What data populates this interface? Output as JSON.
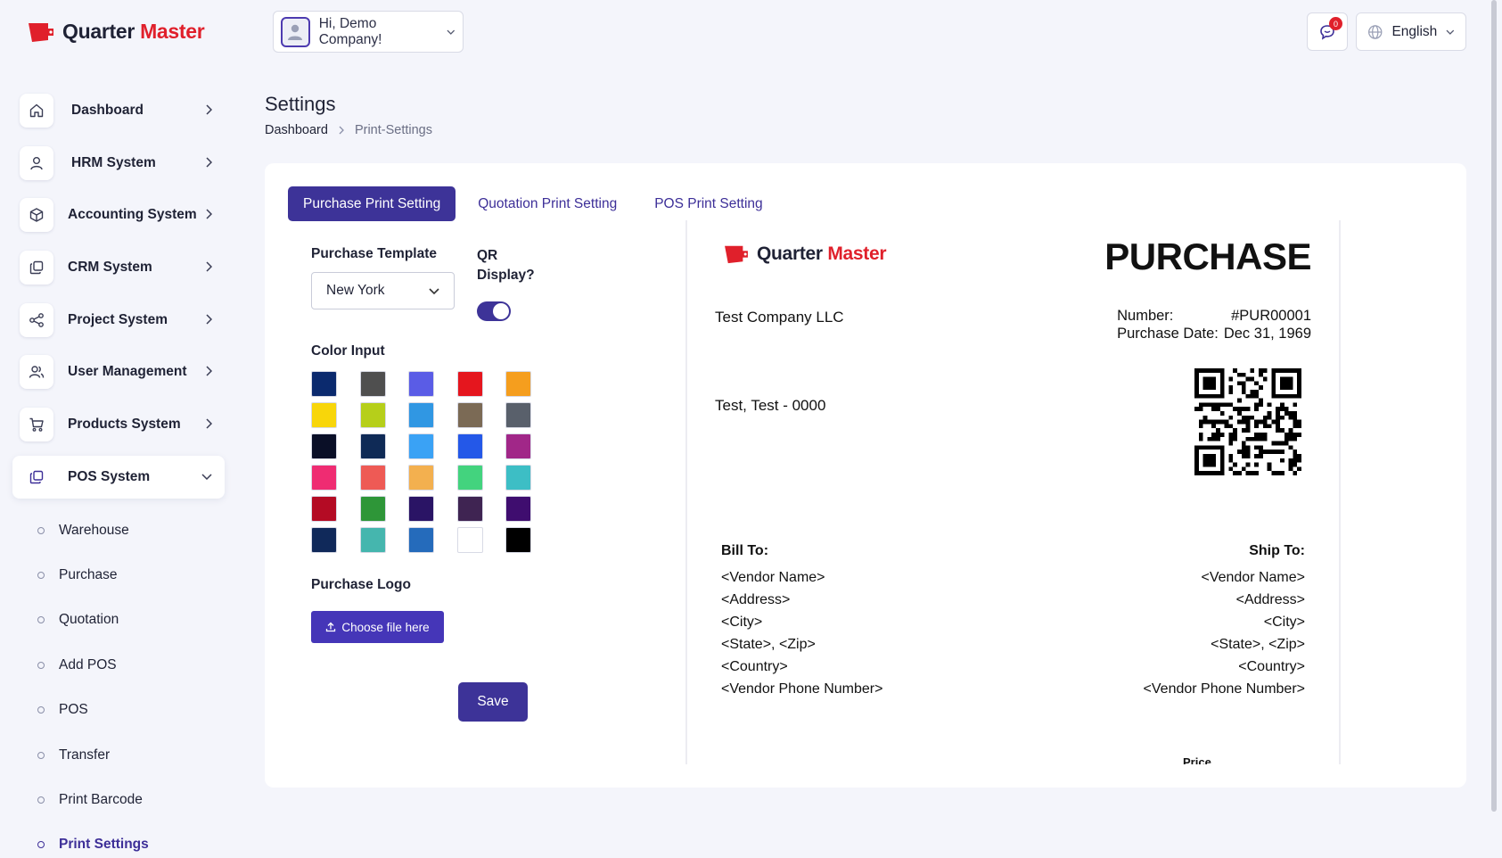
{
  "brand": {
    "name_part1": "Quarter",
    "name_part2": "Master",
    "red": "#e0202b",
    "dark": "#1f2235"
  },
  "header": {
    "greeting": "Hi, Demo Company!",
    "notification_count": "0",
    "language": "English"
  },
  "sidebar": {
    "items": [
      {
        "label": "Dashboard",
        "icon": "home-icon"
      },
      {
        "label": "HRM System",
        "icon": "user-icon"
      },
      {
        "label": "Accounting System",
        "icon": "box-icon"
      },
      {
        "label": "CRM System",
        "icon": "layers-icon"
      },
      {
        "label": "Project System",
        "icon": "share-icon"
      },
      {
        "label": "User Management",
        "icon": "users-icon"
      },
      {
        "label": "Products System",
        "icon": "cart-icon"
      },
      {
        "label": "POS System",
        "icon": "layers-icon"
      }
    ],
    "pos_subitems": [
      "Warehouse",
      "Purchase",
      "Quotation",
      "Add POS",
      "POS",
      "Transfer",
      "Print Barcode",
      "Print Settings"
    ]
  },
  "page": {
    "title": "Settings",
    "breadcrumb": [
      "Dashboard",
      "Print-Settings"
    ]
  },
  "tabs": [
    "Purchase Print Setting",
    "Quotation Print Setting",
    "POS Print Setting"
  ],
  "form": {
    "template_label": "Purchase Template",
    "template_value": "New York",
    "qr_label_line1": "QR",
    "qr_label_line2": "Display?",
    "qr_enabled": true,
    "color_label": "Color Input",
    "colors": [
      "#0b2a6e",
      "#4f4f4f",
      "#5a5ce6",
      "#e5161e",
      "#f59e1e",
      "#f8d60a",
      "#b6cf1a",
      "#3097e3",
      "#7b6a55",
      "#59606b",
      "#0a0f27",
      "#0f2a56",
      "#3aa2f5",
      "#2458e8",
      "#a12788",
      "#ef2c72",
      "#ee5a55",
      "#f3b04f",
      "#43d37e",
      "#3dbec5",
      "#b40b24",
      "#2e9638",
      "#2a1465",
      "#3f2452",
      "#3f0d6f",
      "#10295a",
      "#45b6ae",
      "#256bbb",
      "#ffffff",
      "#000000"
    ],
    "logo_label": "Purchase Logo",
    "upload_label": "Choose file here",
    "save_label": "Save"
  },
  "preview": {
    "title": "PURCHASE",
    "company": "Test Company LLC",
    "address": "Test, Test - 0000",
    "number_label": "Number:",
    "number_value": "#PUR00001",
    "date_label": "Purchase Date:",
    "date_value": "Dec 31, 1969",
    "bill_to": {
      "heading": "Bill To:",
      "lines": [
        "<Vendor Name>",
        "<Address>",
        "<City>",
        "<State>, <Zip>",
        "<Country>",
        "<Vendor Phone Number>"
      ]
    },
    "ship_to": {
      "heading": "Ship To:",
      "lines": [
        "<Vendor Name>",
        "<Address>",
        "<City>",
        "<State>, <Zip>",
        "<Country>",
        "<Vendor Phone Number>"
      ]
    },
    "price_column": "Price"
  }
}
